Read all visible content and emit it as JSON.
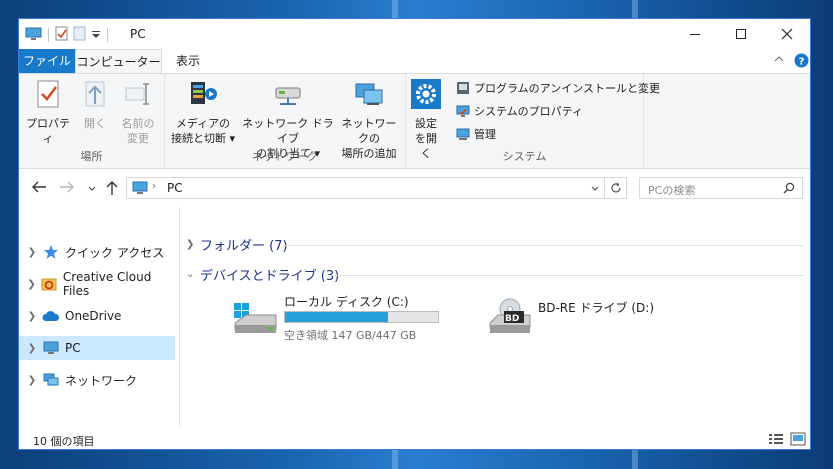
{
  "window": {
    "title": "PC"
  },
  "tabs": {
    "file": "ファイル",
    "computer": "コンピューター",
    "view": "表示"
  },
  "ribbon": {
    "location": {
      "label": "場所",
      "properties": "プロパティ",
      "open": "開く",
      "rename_1": "名前の",
      "rename_2": "変更"
    },
    "network": {
      "label": "ネットワーク",
      "media_1": "メディアの",
      "media_2": "接続と切断",
      "map_1": "ネットワーク ドライブ",
      "map_2": "の割り当て",
      "add_1": "ネットワークの",
      "add_2": "場所の追加"
    },
    "system": {
      "label": "システム",
      "settings_1": "設定",
      "settings_2": "を開く",
      "uninstall": "プログラムのアンインストールと変更",
      "system_properties": "システムのプロパティ",
      "manage": "管理"
    }
  },
  "address": {
    "path": "PC",
    "search_placeholder": "PCの検索"
  },
  "nav": {
    "items": [
      {
        "label": "クイック アクセス"
      },
      {
        "label": "Creative Cloud Files"
      },
      {
        "label": "OneDrive"
      },
      {
        "label": "PC"
      },
      {
        "label": "ネットワーク"
      }
    ]
  },
  "content": {
    "folders_header": "フォルダー (7)",
    "devices_header": "デバイスとドライブ (3)",
    "drives": [
      {
        "name": "ローカル ディスク (C:)",
        "free_text": "空き領域 147 GB/447 GB",
        "used_fraction": 0.67
      },
      {
        "name": "BD-RE ドライブ (D:)",
        "badge": "BD"
      }
    ]
  },
  "status": {
    "item_count": "10 個の項目"
  },
  "colors": {
    "accent": "#1979ca",
    "selected": "#cce8ff",
    "drive_fill": "#26a0da"
  }
}
